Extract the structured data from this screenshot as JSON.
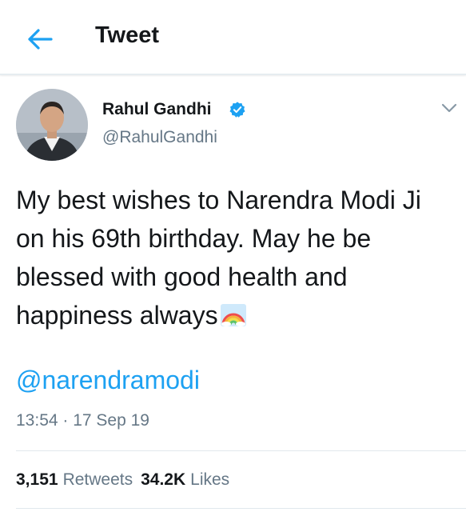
{
  "header": {
    "back_icon": "arrow-left-icon",
    "title": "Tweet"
  },
  "tweet": {
    "author": {
      "name": "Rahul Gandhi",
      "handle": "@RahulGandhi",
      "verified": true,
      "avatar": "avatar-photo"
    },
    "text": "My best wishes to Narendra Modi Ji on his 69th birthday. May he be blessed with good health and happiness always",
    "emoji": "rainbow-emoji",
    "mention": "@narendramodi",
    "timestamp": "13:54 · 17 Sep 19",
    "retweets_count": "3,151",
    "retweets_label": "Retweets",
    "likes_count": "34.2K",
    "likes_label": "Likes"
  },
  "colors": {
    "accent": "#1da1f2",
    "text_primary": "#14171a",
    "text_secondary": "#657786",
    "divider": "#e1e8ed"
  }
}
